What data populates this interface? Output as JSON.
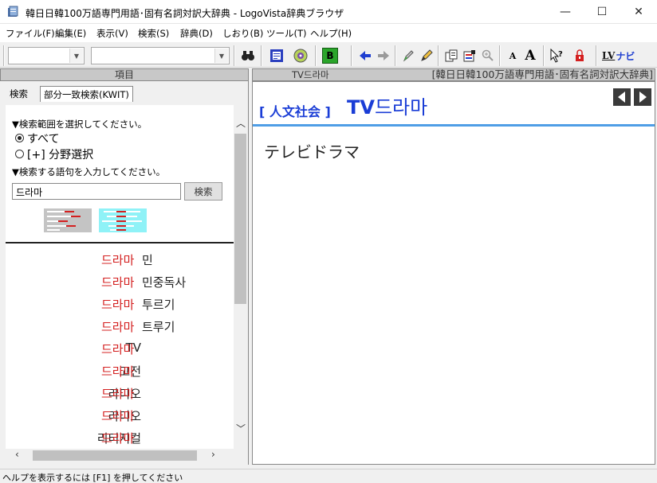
{
  "window": {
    "title": "韓日日韓100万語専門用語･固有名詞対訳大辞典 - LogoVista辞典ブラウザ",
    "controls": {
      "minimize": "—",
      "maximize": "☐",
      "close": "✕"
    }
  },
  "menubar": [
    "ファイル(F)",
    "編集(E)",
    "表示(V)",
    "検索(S)",
    "辞典(D)",
    "しおり(B)",
    "ツール(T)",
    "ヘルプ(H)"
  ],
  "toolbar": {
    "combo1_value": "",
    "combo2_value": "",
    "bold_b_label": "B",
    "font_small_label": "A",
    "font_large_label": "A",
    "lv_label": "LV",
    "navi_label": "ナビ",
    "icons": [
      "binoculars-icon",
      "book-icon",
      "disc-icon",
      "bold-b-icon",
      "back-arrow-icon",
      "forward-arrow-icon",
      "pen-icon",
      "pencil-icon",
      "copy-icon",
      "list-edit-icon",
      "zoom-icon",
      "font-small-icon",
      "font-large-icon",
      "help-cursor-icon",
      "lock-icon",
      "lv-navi-icon"
    ]
  },
  "left_pane": {
    "header": "項目",
    "tabs": [
      {
        "label": "検索",
        "active": false
      },
      {
        "label": "部分一致検索(KWIT)",
        "active": true
      }
    ],
    "scope_prompt": "▼検索範囲を選択してください。",
    "scope_options": [
      {
        "label": "すべて",
        "selected": true
      },
      {
        "label": "[+] 分野選択",
        "selected": false
      }
    ],
    "word_prompt": "▼検索する語句を入力してください。",
    "search_value": "드라마",
    "search_button": "検索",
    "results": [
      {
        "pre": "",
        "hit": "드라마",
        "post": "민"
      },
      {
        "pre": "",
        "hit": "드라마",
        "post": "민중독사"
      },
      {
        "pre": "",
        "hit": "드라마",
        "post": "투르기"
      },
      {
        "pre": "",
        "hit": "드라마",
        "post": "트루기"
      },
      {
        "pre": "TV",
        "hit": "드라마",
        "post": ""
      },
      {
        "pre": "고전",
        "hit": "드라마",
        "post": ""
      },
      {
        "pre": "라디오",
        "hit": "드라마",
        "post": ""
      },
      {
        "pre": "라디오",
        "hit": "드라마",
        "post": ""
      },
      {
        "pre": "리터지컬",
        "hit": "드라마",
        "post": ""
      }
    ]
  },
  "right_pane": {
    "header_word": "TV드라마",
    "header_dict": "[韓日日韓100万語専門用語･固有名詞対訳大辞典]",
    "field_tag": "[ 人文社会 ]",
    "headword_latin": "TV",
    "headword_hangul": "드라마",
    "definition": "テレビドラマ"
  },
  "statusbar": {
    "text": "ヘルプを表示するには [F1] を押してください"
  },
  "colors": {
    "accent_blue": "#1a3dd6",
    "hit_red": "#d42020",
    "rule_blue": "#4f9ee6"
  }
}
